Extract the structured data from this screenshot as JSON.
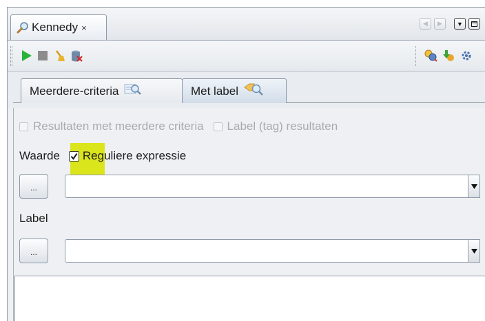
{
  "window": {
    "tab_title": "Kennedy",
    "tab_close": "×",
    "controls": [
      "scroll-left",
      "scroll-right",
      "dropdown",
      "maximize"
    ]
  },
  "toolbar": {
    "left_icons": [
      "play-icon",
      "stop-icon",
      "broom-icon",
      "delete-db-icon"
    ],
    "right_icons": [
      "search-settings-icon",
      "import-icon",
      "options-icon"
    ]
  },
  "tabs": [
    {
      "label": "Meerdere-criteria",
      "icon": "multi-search-icon",
      "active": false
    },
    {
      "label": "Met label",
      "icon": "label-search-icon",
      "active": true
    }
  ],
  "form": {
    "option1_label": "Resultaten met meerdere criteria",
    "option2_label": "Label (tag) resultaten",
    "waarde_label": "Waarde",
    "regex_label": "Reguliere expressie",
    "regex_checked": true,
    "ellipsis_label": "...",
    "label_heading": "Label",
    "waarde_value": "",
    "label_value": ""
  },
  "colors": {
    "highlight": "#dbe51c",
    "play": "#29b23a"
  }
}
